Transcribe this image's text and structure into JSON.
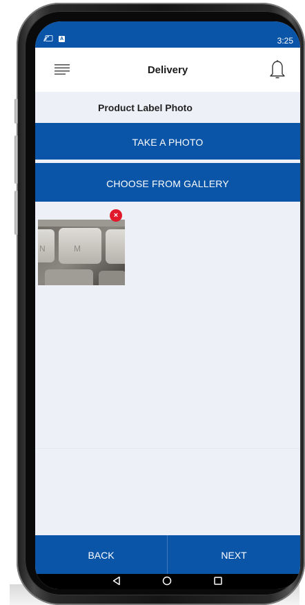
{
  "status_bar": {
    "time": "3:25",
    "icons": [
      "cast-icon",
      "a-badge-icon"
    ],
    "background": "#0b55a8"
  },
  "header": {
    "title": "Delivery",
    "left_icon": "menu-icon",
    "right_icon": "bell-icon"
  },
  "section": {
    "title": "Product Label Photo"
  },
  "actions": {
    "take_photo": "TAKE A PHOTO",
    "choose_gallery": "CHOOSE FROM GALLERY"
  },
  "photos": [
    {
      "description_icon": "keyboard-photo",
      "remove_icon": "close-icon",
      "remove_glyph": "×",
      "key_letters": [
        "N",
        "M"
      ]
    }
  ],
  "footer": {
    "back_label": "BACK",
    "next_label": "NEXT"
  },
  "system_nav": {
    "icons": [
      "back-triangle-icon",
      "home-circle-icon",
      "recents-square-icon"
    ]
  },
  "colors": {
    "primary": "#0b55a8",
    "screen_background": "#edf0f6",
    "remove_badge": "#e0192b"
  }
}
